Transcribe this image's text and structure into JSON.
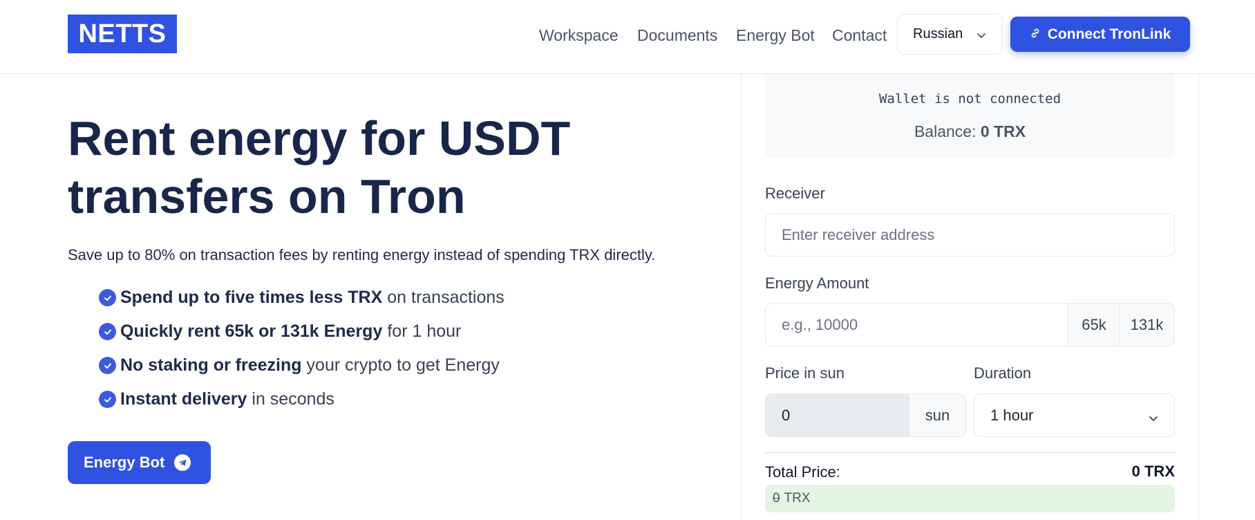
{
  "header": {
    "logo": "NETTS",
    "nav": [
      "Workspace",
      "Documents",
      "Energy Bot",
      "Contact"
    ],
    "language": "Russian",
    "connect_button": "Connect TronLink"
  },
  "hero": {
    "title_line1": "Rent energy for USDT",
    "title_line2": "transfers on Tron",
    "subtitle": "Save up to 80% on transaction fees by renting energy instead of spending TRX directly.",
    "features": [
      {
        "bold": "Spend up to five times less TRX",
        "rest": "on transactions"
      },
      {
        "bold": "Quickly rent 65k or 131k Energy",
        "rest": "for 1 hour"
      },
      {
        "bold": "No staking or freezing",
        "rest": "your crypto to get Energy"
      },
      {
        "bold": "Instant delivery",
        "rest": "in seconds"
      }
    ],
    "energy_bot_button": "Energy Bot"
  },
  "panel": {
    "wallet_status": "Wallet is not connected",
    "balance_label": "Balance:",
    "balance_value": "0 TRX",
    "receiver_label": "Receiver",
    "receiver_placeholder": "Enter receiver address",
    "energy_amount_label": "Energy Amount",
    "energy_amount_placeholder": "e.g., 10000",
    "preset_65k": "65k",
    "preset_131k": "131k",
    "price_label": "Price in sun",
    "price_value": "0",
    "price_unit": "sun",
    "duration_label": "Duration",
    "duration_value": "1 hour",
    "total_label": "Total Price:",
    "total_value": "0 TRX",
    "total_old": "0",
    "total_new": "TRX"
  },
  "colors": {
    "brand": "#2f52e0",
    "heading": "#18264a",
    "success_bg": "#e4f5e3"
  }
}
